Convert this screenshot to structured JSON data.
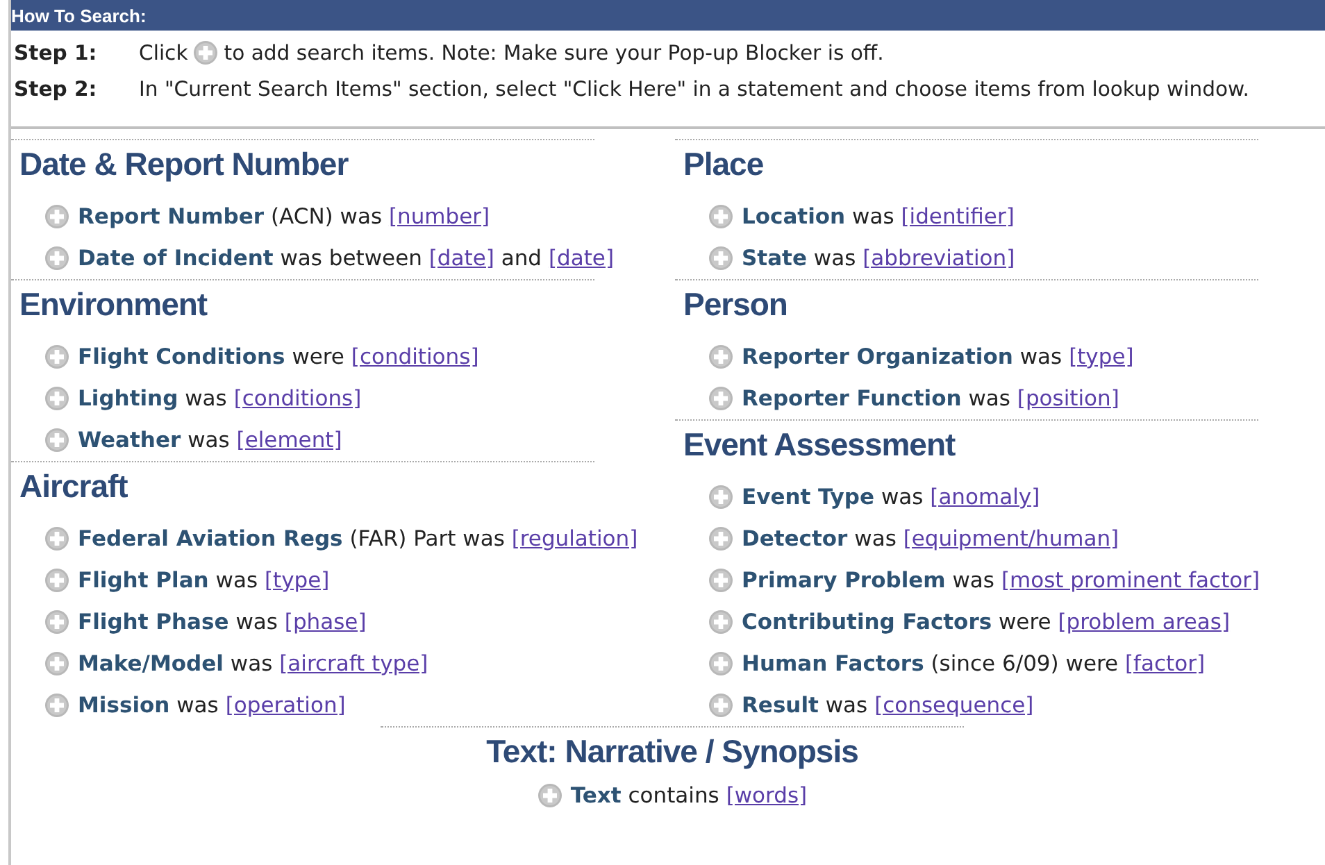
{
  "header": {
    "title": "How To Search:"
  },
  "steps": [
    {
      "label": "Step 1:",
      "parts": [
        {
          "kind": "text",
          "text": "Click"
        },
        {
          "kind": "icon"
        },
        {
          "kind": "text",
          "text": "to add search items. Note: Make sure your Pop-up Blocker is off."
        }
      ]
    },
    {
      "label": "Step 2:",
      "parts": [
        {
          "kind": "text",
          "text": "In \"Current Search Items\" section, select \"Click Here\" in a statement and choose items from lookup window."
        }
      ]
    }
  ],
  "columns": [
    [
      {
        "title": "Date & Report Number",
        "items": [
          [
            {
              "kind": "field",
              "text": "Report Number"
            },
            {
              "kind": "text",
              "text": "(ACN) was"
            },
            {
              "kind": "link",
              "text": "[number]"
            }
          ],
          [
            {
              "kind": "field",
              "text": "Date of Incident"
            },
            {
              "kind": "text",
              "text": "was between"
            },
            {
              "kind": "link",
              "text": "[date]"
            },
            {
              "kind": "text",
              "text": "and"
            },
            {
              "kind": "link",
              "text": "[date]"
            }
          ]
        ]
      },
      {
        "title": "Environment",
        "items": [
          [
            {
              "kind": "field",
              "text": "Flight Conditions"
            },
            {
              "kind": "text",
              "text": "were"
            },
            {
              "kind": "link",
              "text": "[conditions]"
            }
          ],
          [
            {
              "kind": "field",
              "text": "Lighting"
            },
            {
              "kind": "text",
              "text": "was"
            },
            {
              "kind": "link",
              "text": "[conditions]"
            }
          ],
          [
            {
              "kind": "field",
              "text": "Weather"
            },
            {
              "kind": "text",
              "text": "was"
            },
            {
              "kind": "link",
              "text": "[element]"
            }
          ]
        ]
      },
      {
        "title": "Aircraft",
        "items": [
          [
            {
              "kind": "field",
              "text": "Federal Aviation Regs"
            },
            {
              "kind": "text",
              "text": "(FAR) Part was"
            },
            {
              "kind": "link",
              "text": "[regulation]"
            }
          ],
          [
            {
              "kind": "field",
              "text": "Flight Plan"
            },
            {
              "kind": "text",
              "text": "was"
            },
            {
              "kind": "link",
              "text": "[type]"
            }
          ],
          [
            {
              "kind": "field",
              "text": "Flight Phase"
            },
            {
              "kind": "text",
              "text": "was"
            },
            {
              "kind": "link",
              "text": "[phase]"
            }
          ],
          [
            {
              "kind": "field",
              "text": "Make/Model"
            },
            {
              "kind": "text",
              "text": "was"
            },
            {
              "kind": "link",
              "text": "[aircraft type]"
            }
          ],
          [
            {
              "kind": "field",
              "text": "Mission"
            },
            {
              "kind": "text",
              "text": "was"
            },
            {
              "kind": "link",
              "text": "[operation]"
            }
          ]
        ]
      }
    ],
    [
      {
        "title": "Place",
        "items": [
          [
            {
              "kind": "field",
              "text": "Location"
            },
            {
              "kind": "text",
              "text": "was"
            },
            {
              "kind": "link",
              "text": "[identifier]"
            }
          ],
          [
            {
              "kind": "field",
              "text": "State"
            },
            {
              "kind": "text",
              "text": "was"
            },
            {
              "kind": "link",
              "text": "[abbreviation]"
            }
          ]
        ]
      },
      {
        "title": "Person",
        "items": [
          [
            {
              "kind": "field",
              "text": "Reporter Organization"
            },
            {
              "kind": "text",
              "text": "was"
            },
            {
              "kind": "link",
              "text": "[type]"
            }
          ],
          [
            {
              "kind": "field",
              "text": "Reporter Function"
            },
            {
              "kind": "text",
              "text": "was"
            },
            {
              "kind": "link",
              "text": "[position]"
            }
          ]
        ]
      },
      {
        "title": "Event Assessment",
        "items": [
          [
            {
              "kind": "field",
              "text": "Event Type"
            },
            {
              "kind": "text",
              "text": "was"
            },
            {
              "kind": "link",
              "text": "[anomaly]"
            }
          ],
          [
            {
              "kind": "field",
              "text": "Detector"
            },
            {
              "kind": "text",
              "text": "was"
            },
            {
              "kind": "link",
              "text": "[equipment/human]"
            }
          ],
          [
            {
              "kind": "field",
              "text": "Primary Problem"
            },
            {
              "kind": "text",
              "text": "was"
            },
            {
              "kind": "link",
              "text": "[most prominent factor]"
            }
          ],
          [
            {
              "kind": "field",
              "text": "Contributing Factors"
            },
            {
              "kind": "text",
              "text": "were"
            },
            {
              "kind": "link",
              "text": "[problem areas]"
            }
          ],
          [
            {
              "kind": "field",
              "text": "Human Factors"
            },
            {
              "kind": "text",
              "text": "(since 6/09) were"
            },
            {
              "kind": "link",
              "text": "[factor]"
            }
          ],
          [
            {
              "kind": "field",
              "text": "Result"
            },
            {
              "kind": "text",
              "text": "was"
            },
            {
              "kind": "link",
              "text": "[consequence]"
            }
          ]
        ]
      }
    ]
  ],
  "bottom": {
    "title": "Text: Narrative / Synopsis",
    "items": [
      [
        {
          "kind": "field",
          "text": "Text"
        },
        {
          "kind": "text",
          "text": "contains"
        },
        {
          "kind": "link",
          "text": "[words]"
        }
      ]
    ]
  }
}
